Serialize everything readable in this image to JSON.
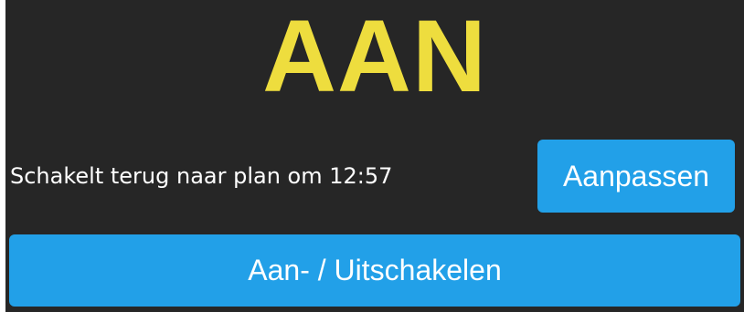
{
  "state": {
    "label": "AAN",
    "color": "#eedd3e"
  },
  "schedule": {
    "status_text": "Schakelt terug naar plan om 12:57",
    "adjust_label": "Aanpassen"
  },
  "controls": {
    "toggle_label": "Aan- / Uitschakelen"
  },
  "colors": {
    "background": "#262626",
    "button": "#22a0e8",
    "text": "#ffffff"
  }
}
